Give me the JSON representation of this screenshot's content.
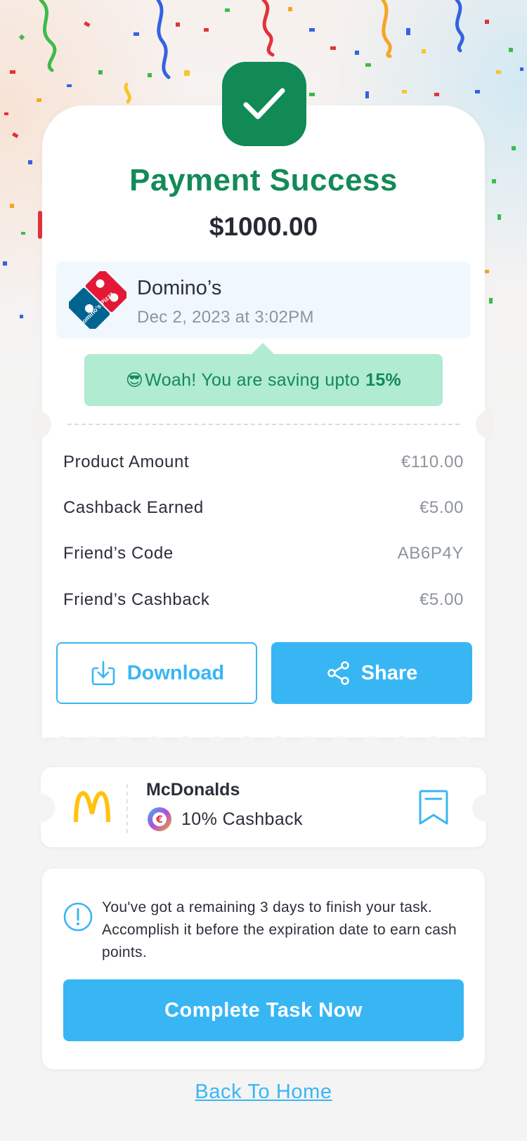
{
  "header": {
    "title": "Payment Success",
    "amount": "$1000.00"
  },
  "merchant": {
    "name": "Domino’s",
    "datetime": "Dec 2, 2023 at 3:02PM",
    "logo_icon": "dominos-logo-icon",
    "logo_text": "Domino's Pizza"
  },
  "saving": {
    "emoji": "😎",
    "text": "Woah! You are saving upto",
    "percent": "15%"
  },
  "details": [
    {
      "label": "Product Amount",
      "value": "€110.00"
    },
    {
      "label": "Cashback Earned",
      "value": "€5.00"
    },
    {
      "label": "Friend’s Code",
      "value": "AB6P4Y"
    },
    {
      "label": "Friend’s Cashback",
      "value": "€5.00"
    }
  ],
  "actions": {
    "download_label": "Download",
    "download_icon": "download-icon",
    "share_label": "Share",
    "share_icon": "share-icon"
  },
  "offer": {
    "brand": "McDonalds",
    "cashback": "10% Cashback",
    "logo_icon": "mcdonalds-logo-icon",
    "coin_icon": "euro-coin-icon",
    "bookmark_icon": "bookmark-icon"
  },
  "task": {
    "icon": "info-icon",
    "message": "You've got a remaining 3 days to finish your task. Accomplish it before the expiration date to earn cash points.",
    "button_label": "Complete Task Now"
  },
  "footer": {
    "back_label": "Back To Home"
  },
  "colors": {
    "success_green": "#138a57",
    "accent_blue": "#38b6f4",
    "saving_bg": "#b1ebd2",
    "merchant_bg": "#f1f8fd"
  }
}
